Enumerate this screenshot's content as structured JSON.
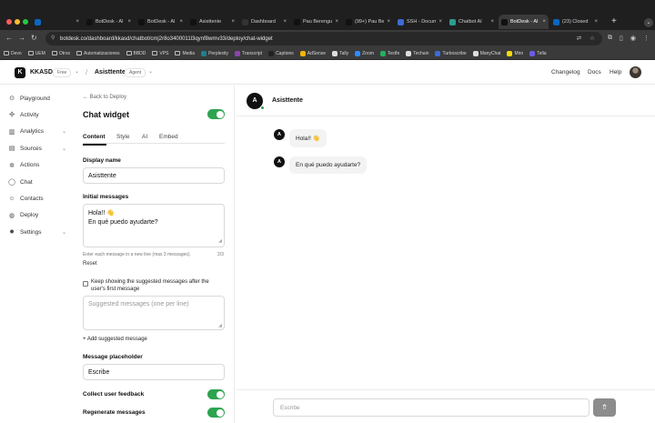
{
  "browser": {
    "tabs": [
      {
        "label": "",
        "color": "#0a66c2"
      },
      {
        "label": "BotDesk - AI",
        "color": "#111111"
      },
      {
        "label": "BotDesk - AI",
        "color": "#111111"
      },
      {
        "label": "Asisttente",
        "color": "#111111"
      },
      {
        "label": "Dashboard",
        "color": "#333333"
      },
      {
        "label": "Pau Berengu",
        "color": "#111111"
      },
      {
        "label": "(99+) Pau Be",
        "color": "#111111"
      },
      {
        "label": "SSH - Docum",
        "color": "#3b6bd6"
      },
      {
        "label": "Chatbot AI",
        "color": "#2a9d8f"
      },
      {
        "label": "BotDesk - AI",
        "color": "#111111"
      },
      {
        "label": "(23) Closed",
        "color": "#0a66c2"
      }
    ],
    "url": "botdesk.co/dashboard/kkasd/chatbot/cmj2r8o3400011l3qynf8wmv33/deploy/chat-widget",
    "bookmarks": [
      {
        "label": "Devo",
        "type": "folder"
      },
      {
        "label": "UEM",
        "type": "folder"
      },
      {
        "label": "Otros",
        "type": "folder"
      },
      {
        "label": "Automatizaciones",
        "type": "folder"
      },
      {
        "label": "BBDD",
        "type": "folder"
      },
      {
        "label": "VPS",
        "type": "folder"
      },
      {
        "label": "Media",
        "type": "folder"
      },
      {
        "label": "Perplexity",
        "type": "site",
        "color": "#20808d"
      },
      {
        "label": "Transcript",
        "type": "site",
        "color": "#8e44ad"
      },
      {
        "label": "Captions",
        "type": "site",
        "color": "#222222"
      },
      {
        "label": "AdSense",
        "type": "site",
        "color": "#f4b400"
      },
      {
        "label": "Tally",
        "type": "site",
        "color": "#dddddd"
      },
      {
        "label": "Zoom",
        "type": "site",
        "color": "#2d8cff"
      },
      {
        "label": "Textfe",
        "type": "site",
        "color": "#27ae60"
      },
      {
        "label": "Techain",
        "type": "site",
        "color": "#dddddd"
      },
      {
        "label": "Turboscribe",
        "type": "site",
        "color": "#3b6bd6"
      },
      {
        "label": "ManyChat",
        "type": "site",
        "color": "#dddddd"
      },
      {
        "label": "Miro",
        "type": "site",
        "color": "#f5d90a"
      },
      {
        "label": "Tella",
        "type": "site",
        "color": "#6c5ce7"
      }
    ]
  },
  "header": {
    "logo_letter": "K",
    "workspace": "KKASD",
    "plan_badge": "Free",
    "bot_name": "Asisttente",
    "bot_badge": "Agent",
    "links": [
      "Changelog",
      "Docs",
      "Help"
    ]
  },
  "sidebar": {
    "items": [
      {
        "label": "Playground",
        "icon": "play-icon",
        "glyph": "⊙",
        "expandable": false
      },
      {
        "label": "Activity",
        "icon": "activity-icon",
        "glyph": "✣",
        "expandable": false
      },
      {
        "label": "Analytics",
        "icon": "analytics-icon",
        "glyph": "▥",
        "expandable": true
      },
      {
        "label": "Sources",
        "icon": "sources-icon",
        "glyph": "▤",
        "expandable": true
      },
      {
        "label": "Actions",
        "icon": "actions-icon",
        "glyph": "✲",
        "expandable": false
      },
      {
        "label": "Chat",
        "icon": "chat-icon",
        "glyph": "◯",
        "expandable": false
      },
      {
        "label": "Contacts",
        "icon": "contacts-icon",
        "glyph": "☺",
        "expandable": false
      },
      {
        "label": "Deploy",
        "icon": "deploy-icon",
        "glyph": "◍",
        "expandable": false
      },
      {
        "label": "Settings",
        "icon": "settings-icon",
        "glyph": "✹",
        "expandable": true
      }
    ]
  },
  "config": {
    "back_label": "← Back to Deploy",
    "title": "Chat widget",
    "widget_enabled": true,
    "tabs": [
      "Content",
      "Style",
      "AI",
      "Embed"
    ],
    "active_tab": "Content",
    "display_name_label": "Display name",
    "display_name_value": "Asisttente",
    "initial_messages_label": "Initial messages",
    "initial_messages_lines": [
      "Hola!! 👋",
      "En qué puedo ayudarte?"
    ],
    "initial_messages_hint": "Enter each message in a new line (max 3 messages).",
    "initial_messages_count": "2/3",
    "reset_label": "Reset",
    "keep_suggested_label": "Keep showing the suggested messages after the user's first message",
    "keep_suggested_checked": false,
    "suggested_placeholder": "Suggested messages (one per line)",
    "add_suggested_label": "+ Add suggested message",
    "message_placeholder_label": "Message placeholder",
    "message_placeholder_value": "Escribe",
    "collect_feedback_label": "Collect user feedback",
    "collect_feedback_enabled": true,
    "regenerate_label": "Regenerate messages",
    "regenerate_enabled": true
  },
  "preview": {
    "avatar_letter": "A",
    "title": "Asisttente",
    "messages": [
      "Hola!! 👋",
      "En qué puedo ayudarte?"
    ],
    "input_placeholder": "Escribe",
    "send_glyph": "⇮"
  },
  "colors": {
    "accent_green": "#2ea44f",
    "chrome_dark": "#1f1f1f"
  }
}
